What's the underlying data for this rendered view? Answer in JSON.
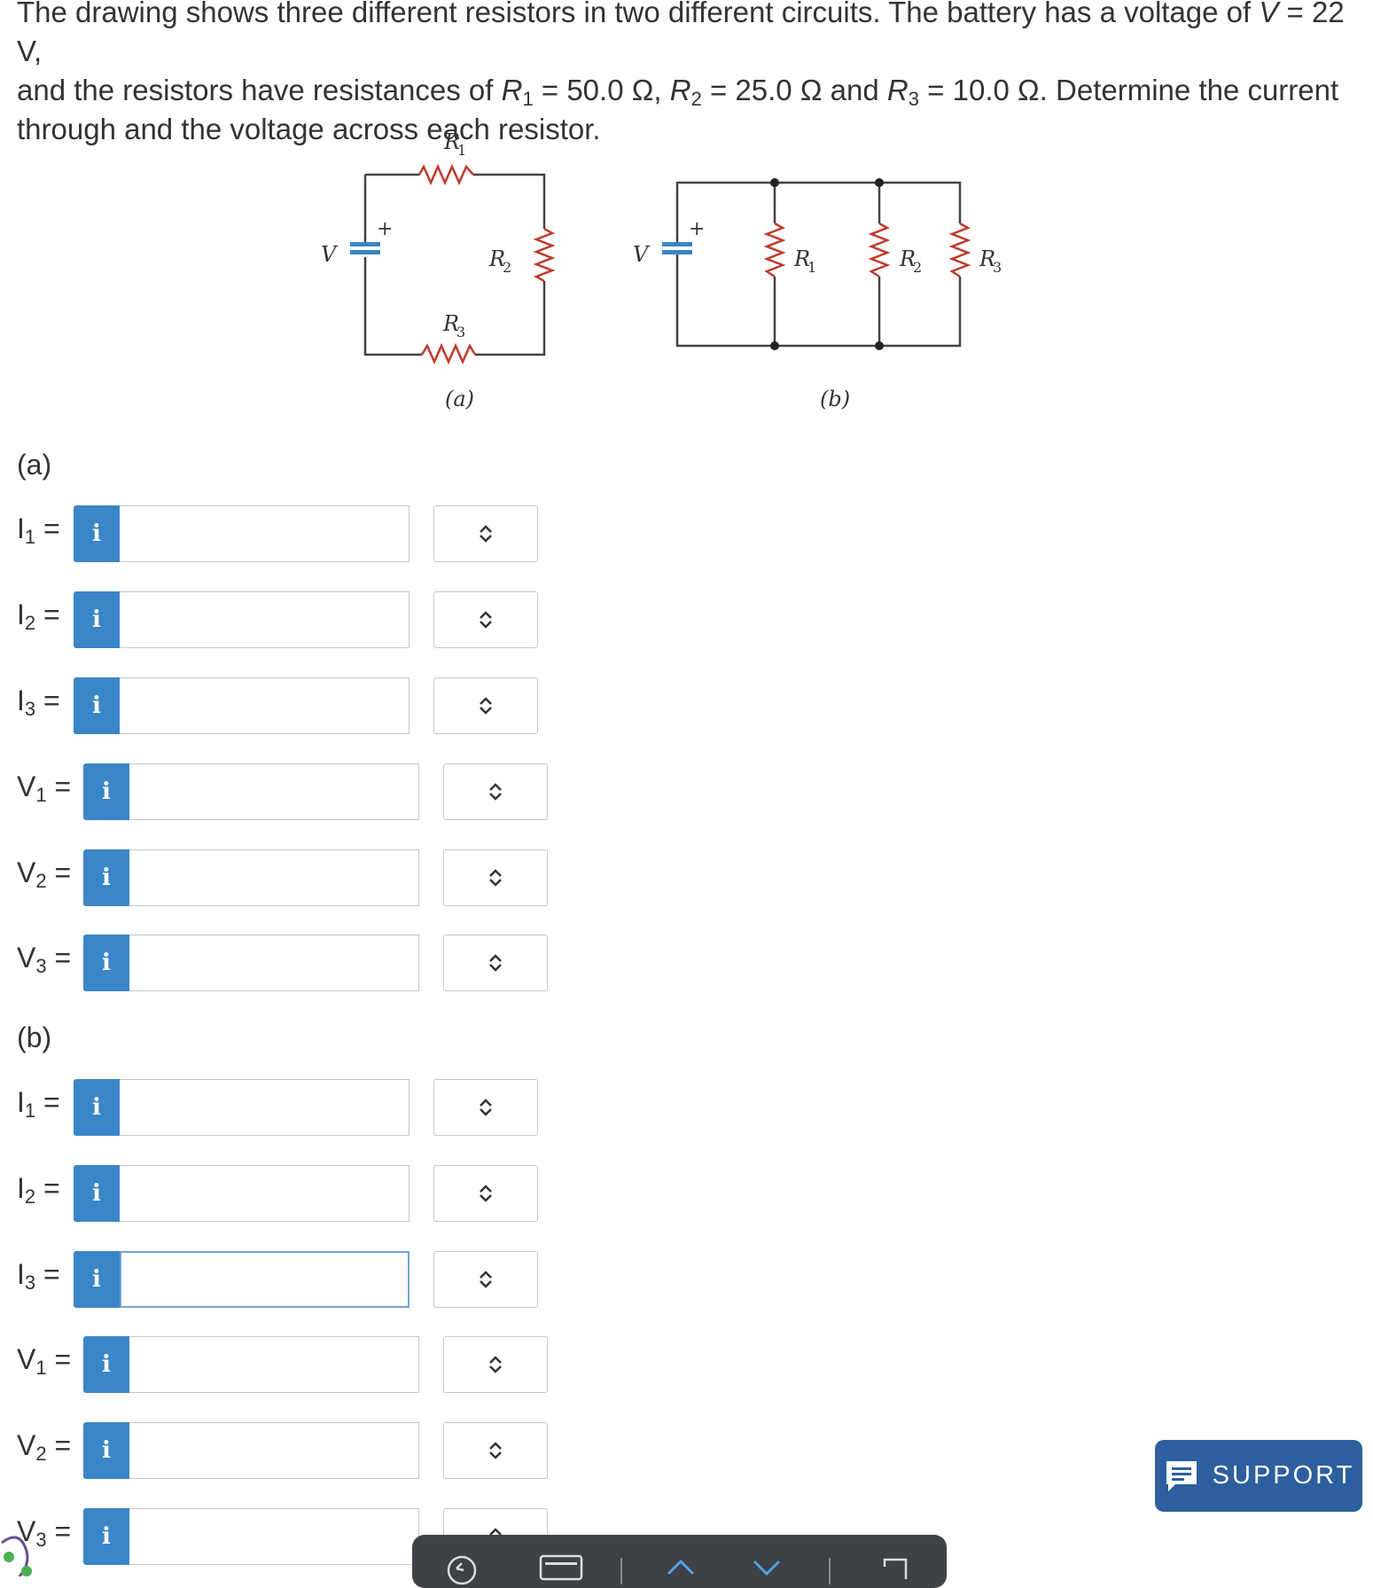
{
  "problem": {
    "text_a": "The drawing shows three different resistors in two different circuits. The battery has a voltage of ",
    "V_sym": "V",
    "text_b": " = 22 V,",
    "text_c": "and the resistors have resistances of ",
    "R1_sym": "R",
    "R1_sub": "1",
    "R1_val": " = 50.0 Ω, ",
    "R2_sym": "R",
    "R2_sub": "2",
    "R2_val": " = 25.0 Ω and ",
    "R3_sym": "R",
    "R3_sub": "3",
    "R3_val": " = 10.0 Ω. Determine the current",
    "text_d": "through and the voltage across each resistor."
  },
  "figure": {
    "a": {
      "caption": "(a)",
      "V": "V",
      "plus": "+",
      "R1": "R",
      "R1_sub": "1",
      "R2": "R",
      "R2_sub": "2",
      "R3": "R",
      "R3_sub": "3"
    },
    "b": {
      "caption": "(b)",
      "V": "V",
      "plus": "+",
      "R1": "R",
      "R1_sub": "1",
      "R2": "R",
      "R2_sub": "2",
      "R3": "R",
      "R3_sub": "3"
    }
  },
  "sections": [
    {
      "label": "(a)",
      "rows": [
        {
          "sym": "I",
          "sub": "1",
          "eq": " =",
          "info": "i",
          "value": "",
          "unit": ""
        },
        {
          "sym": "I",
          "sub": "2",
          "eq": " =",
          "info": "i",
          "value": "",
          "unit": ""
        },
        {
          "sym": "I",
          "sub": "3",
          "eq": " =",
          "info": "i",
          "value": "",
          "unit": ""
        },
        {
          "sym": "V",
          "sub": "1",
          "eq": " =",
          "info": "i",
          "value": "",
          "unit": ""
        },
        {
          "sym": "V",
          "sub": "2",
          "eq": " =",
          "info": "i",
          "value": "",
          "unit": ""
        },
        {
          "sym": "V",
          "sub": "3",
          "eq": " =",
          "info": "i",
          "value": "",
          "unit": ""
        }
      ]
    },
    {
      "label": "(b)",
      "rows": [
        {
          "sym": "I",
          "sub": "1",
          "eq": " =",
          "info": "i",
          "value": "",
          "unit": ""
        },
        {
          "sym": "I",
          "sub": "2",
          "eq": " =",
          "info": "i",
          "value": "",
          "unit": ""
        },
        {
          "sym": "I",
          "sub": "3",
          "eq": " =",
          "info": "i",
          "value": "",
          "unit": ""
        },
        {
          "sym": "V",
          "sub": "1",
          "eq": " =",
          "info": "i",
          "value": "",
          "unit": ""
        },
        {
          "sym": "V",
          "sub": "2",
          "eq": " =",
          "info": "i",
          "value": "",
          "unit": ""
        },
        {
          "sym": "V",
          "sub": "3",
          "eq": " =",
          "info": "i",
          "value": "",
          "unit": ""
        }
      ]
    }
  ],
  "support": {
    "label": "SUPPORT",
    "icon": "chat-icon"
  },
  "colors": {
    "info_blue": "#3a86c8",
    "support_bg": "#2d5f9e",
    "toolbar_bg": "#3e4145",
    "battery_blue": "#3a86c8"
  },
  "toolbar": {
    "icons": [
      "undo-icon",
      "keyboard-icon",
      "chevron-up-icon",
      "chevron-down-icon",
      "expand-icon"
    ]
  }
}
